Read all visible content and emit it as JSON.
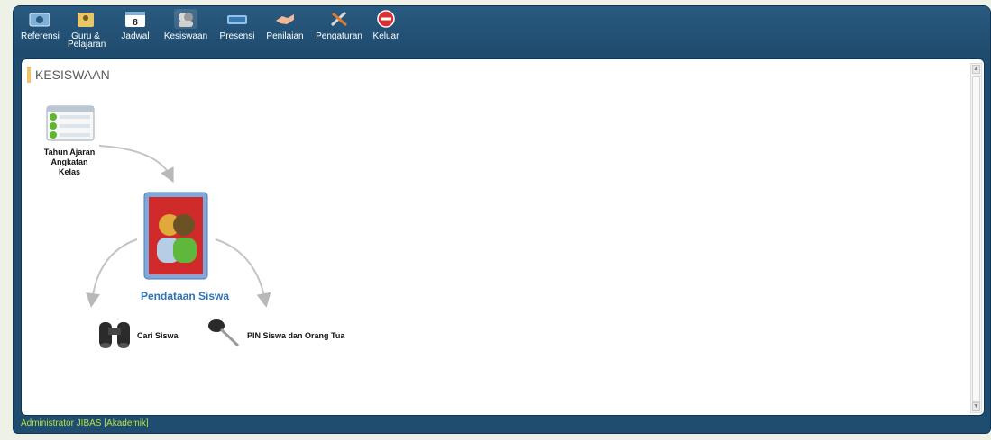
{
  "toolbar": {
    "items": [
      {
        "label": "Referensi"
      },
      {
        "label": "Guru &",
        "label2": "Pelajaran"
      },
      {
        "label": "Jadwal"
      },
      {
        "label": "Kesiswaan"
      },
      {
        "label": "Presensi"
      },
      {
        "label": "Penilaian"
      },
      {
        "label": "Pengaturan"
      },
      {
        "label": "Keluar"
      }
    ],
    "active": "Kesiswaan",
    "jadwal_icon_number": "8"
  },
  "content": {
    "title": "KESISWAAN",
    "diagram": {
      "top_node": {
        "line1": "Tahun Ajaran",
        "line2": "Angkatan",
        "line3": "Kelas"
      },
      "main_node": {
        "label": "Pendataan Siswa"
      },
      "left_node": {
        "label": "Cari Siswa"
      },
      "right_node": {
        "label": "PIN Siswa dan Orang Tua"
      }
    }
  },
  "status": {
    "text": "Administrator JIBAS [Akademik]"
  },
  "colors": {
    "frame": "#1f4d70",
    "accent": "#f2c36a",
    "main_link": "#2f74b5",
    "status_text": "#b8e040"
  }
}
